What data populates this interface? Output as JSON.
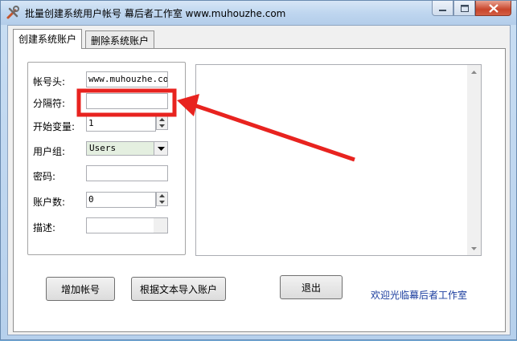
{
  "window": {
    "title": "批量创建系统用户帐号  幕后者工作室  www.muhouzhe.com",
    "controls": {
      "minimize_icon": "minimize-icon",
      "maximize_icon": "maximize-icon",
      "close_icon": "close-icon"
    }
  },
  "tabs": [
    {
      "label": "创建系统账户",
      "active": true
    },
    {
      "label": "删除系统账户",
      "active": false
    }
  ],
  "form": {
    "prefix_label": "帐号头:",
    "prefix_value": "www.muhouzhe.com",
    "separator_label": "分隔符:",
    "separator_value": "",
    "start_label": "开始变量:",
    "start_value": "1",
    "group_label": "用户组:",
    "group_value": "Users",
    "password_label": "密码:",
    "password_value": "",
    "count_label": "账户数:",
    "count_value": "0",
    "desc_label": "描述:",
    "desc_value": ""
  },
  "buttons": {
    "add_account": "增加帐号",
    "import_from_text": "根据文本导入账户",
    "exit": "退出"
  },
  "welcome_text": "欢迎光临幕后者工作室",
  "colors": {
    "annotation_red": "#e8231f",
    "link_blue": "#1a3c9e",
    "combo_bg": "#e4efe0"
  }
}
